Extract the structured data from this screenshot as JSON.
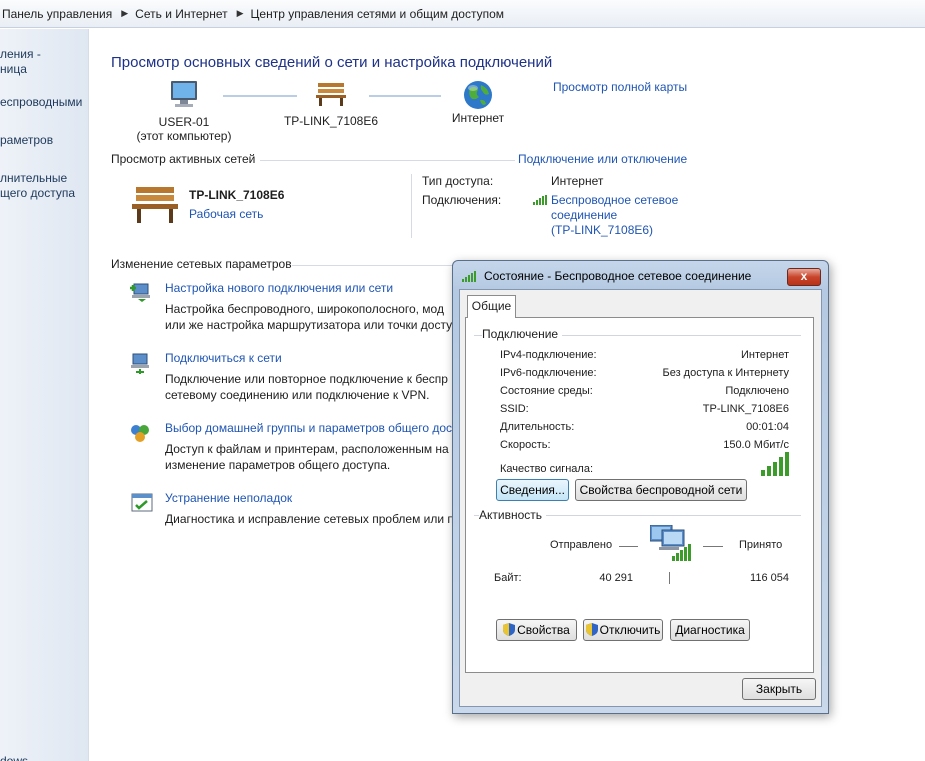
{
  "breadcrumb": [
    "Панель управления",
    "Сеть и Интернет",
    "Центр управления сетями и общим доступом"
  ],
  "leftnav": {
    "items": [
      "ления -",
      "ница",
      "еспроводными",
      "раметров",
      "лнительные",
      "щего доступа",
      "dows"
    ]
  },
  "main": {
    "title": "Просмотр основных сведений о сети и настройка подключений",
    "full_map_link": "Просмотр полной карты",
    "map": {
      "computer_name": "USER-01",
      "computer_note": "(этот компьютер)",
      "network_name": "TP-LINK_7108E6",
      "internet": "Интернет"
    },
    "active_header": "Просмотр активных сетей",
    "connect_disconnect_link": "Подключение или отключение",
    "active_network": {
      "name": "TP-LINK_7108E6",
      "type": "Рабочая сеть",
      "access_type_label": "Тип доступа:",
      "access_type_value": "Интернет",
      "connections_label": "Подключения:",
      "connection_line1": "Беспроводное сетевое",
      "connection_line2": "соединение",
      "connection_line3": "(TP-LINK_7108E6)"
    },
    "change_header": "Изменение сетевых параметров",
    "tasks": [
      {
        "link": "Настройка нового подключения или сети",
        "desc1": "Настройка беспроводного, широкополосного, мод",
        "desc2": "или же настройка маршрутизатора или точки досту",
        "icon": "new-connection-icon"
      },
      {
        "link": "Подключиться к сети",
        "desc1": "Подключение или повторное подключение к беспр",
        "desc2": "сетевому соединению или подключение к VPN.",
        "icon": "connect-network-icon"
      },
      {
        "link": "Выбор домашней группы и параметров общего дос",
        "desc1": "Доступ к файлам и принтерам, расположенным на",
        "desc2": "изменение параметров общего доступа.",
        "icon": "homegroup-icon"
      },
      {
        "link": "Устранение неполадок",
        "desc1": "Диагностика и исправление сетевых проблем или п",
        "desc2": "",
        "icon": "troubleshoot-icon"
      }
    ]
  },
  "dialog": {
    "title": "Состояние - Беспроводное сетевое соединение",
    "close_label": "x",
    "tab_label": "Общие",
    "connection_group": "Подключение",
    "rows": [
      {
        "k": "IPv4-подключение:",
        "v": "Интернет"
      },
      {
        "k": "IPv6-подключение:",
        "v": "Без доступа к Интернету"
      },
      {
        "k": "Состояние среды:",
        "v": "Подключено"
      },
      {
        "k": "SSID:",
        "v": "TP-LINK_7108E6"
      },
      {
        "k": "Длительность:",
        "v": "00:01:04"
      },
      {
        "k": "Скорость:",
        "v": "150.0 Мбит/с"
      }
    ],
    "signal_label": "Качество сигнала:",
    "signal_bars": 5,
    "details_button": "Сведения...",
    "wireless_props_button": "Свойства беспроводной сети",
    "activity_group": "Активность",
    "sent_label": "Отправлено",
    "received_label": "Принято",
    "bytes_label": "Байт:",
    "bytes_sent": "40 291",
    "bytes_received": "116 054",
    "properties_button": "Свойства",
    "disable_button": "Отключить",
    "diagnose_button": "Диагностика",
    "close_button": "Закрыть"
  },
  "colors": {
    "link": "#1f55b3",
    "title": "#1e3287",
    "signal": "#3c9b2a"
  }
}
